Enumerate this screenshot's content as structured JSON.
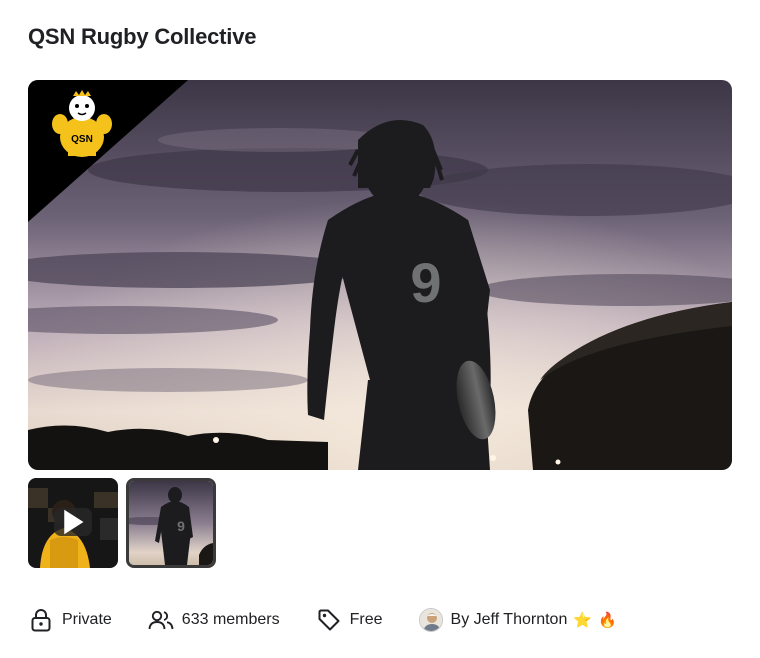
{
  "group": {
    "title": "QSN Rugby Collective",
    "logo_text": "QSN",
    "hero_jersey_number": "9"
  },
  "gallery": {
    "thumbnails": [
      {
        "kind": "video",
        "icon": "play-icon",
        "selected": false
      },
      {
        "kind": "image",
        "jersey_number": "9",
        "selected": true
      }
    ]
  },
  "meta": {
    "privacy_label": "Private",
    "privacy_icon": "lock-icon",
    "members_label": "633 members",
    "members_icon": "users-icon",
    "price_label": "Free",
    "price_icon": "tag-icon",
    "owner_label": "By Jeff Thornton",
    "owner_badges": [
      "⭐",
      "🔥"
    ]
  }
}
